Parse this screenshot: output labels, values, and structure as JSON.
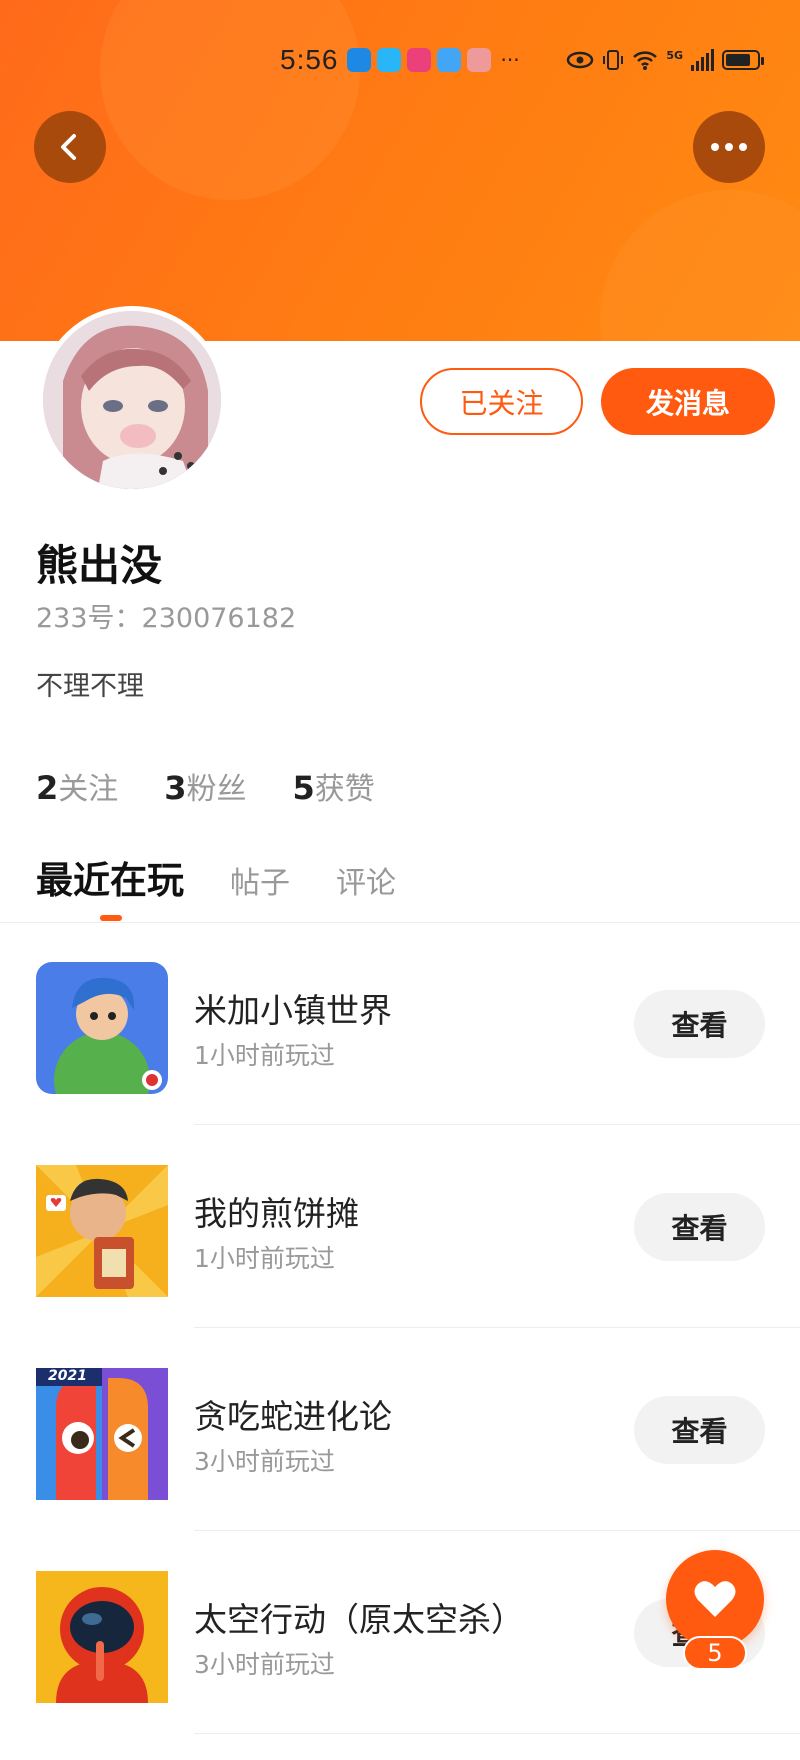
{
  "status_bar": {
    "time": "5:56",
    "more": "···",
    "network": "5G"
  },
  "profile": {
    "name": "熊出没",
    "uid": "233号：230076182",
    "bio": "不理不理"
  },
  "actions": {
    "follow_label": "已关注",
    "message_label": "发消息"
  },
  "stats": [
    {
      "num": "2",
      "label": "关注"
    },
    {
      "num": "3",
      "label": "粉丝"
    },
    {
      "num": "5",
      "label": "获赞"
    }
  ],
  "tabs": [
    {
      "label": "最近在玩",
      "active": true
    },
    {
      "label": "帖子",
      "active": false
    },
    {
      "label": "评论",
      "active": false
    }
  ],
  "games": [
    {
      "name": "米加小镇世界",
      "time": "1小时前玩过",
      "button": "查看"
    },
    {
      "name": "我的煎饼摊",
      "time": "1小时前玩过",
      "button": "查看"
    },
    {
      "name": "贪吃蛇进化论",
      "time": "3小时前玩过",
      "button": "查看"
    },
    {
      "name": "太空行动（原太空杀）",
      "time": "3小时前玩过",
      "button": "查看"
    }
  ],
  "game_icon_badge": "2021",
  "fab": {
    "count": "5"
  },
  "colors": {
    "accent": "#ff5a10",
    "header": "#ff7a14"
  }
}
